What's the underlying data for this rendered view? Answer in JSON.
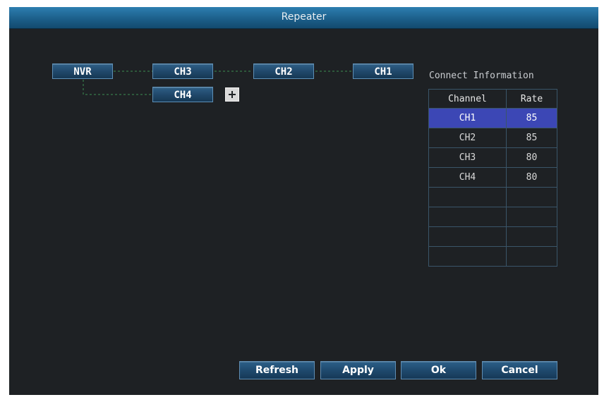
{
  "window": {
    "title": "Repeater"
  },
  "topology": {
    "nodes": {
      "nvr": "NVR",
      "ch3": "CH3",
      "ch2": "CH2",
      "ch1": "CH1",
      "ch4": "CH4"
    },
    "link_color": "#3c8f52",
    "add_icon": "plus-box-icon"
  },
  "connect_info": {
    "title": "Connect Information",
    "columns": [
      "Channel",
      "Rate"
    ],
    "rows": [
      {
        "channel": "CH1",
        "rate": "85",
        "selected": true
      },
      {
        "channel": "CH2",
        "rate": "85"
      },
      {
        "channel": "CH3",
        "rate": "80"
      },
      {
        "channel": "CH4",
        "rate": "80"
      },
      {
        "channel": "",
        "rate": ""
      },
      {
        "channel": "",
        "rate": ""
      },
      {
        "channel": "",
        "rate": ""
      },
      {
        "channel": "",
        "rate": ""
      }
    ],
    "selected_color": "#3c47b5"
  },
  "buttons": {
    "refresh": "Refresh",
    "apply": "Apply",
    "ok": "Ok",
    "cancel": "Cancel"
  }
}
